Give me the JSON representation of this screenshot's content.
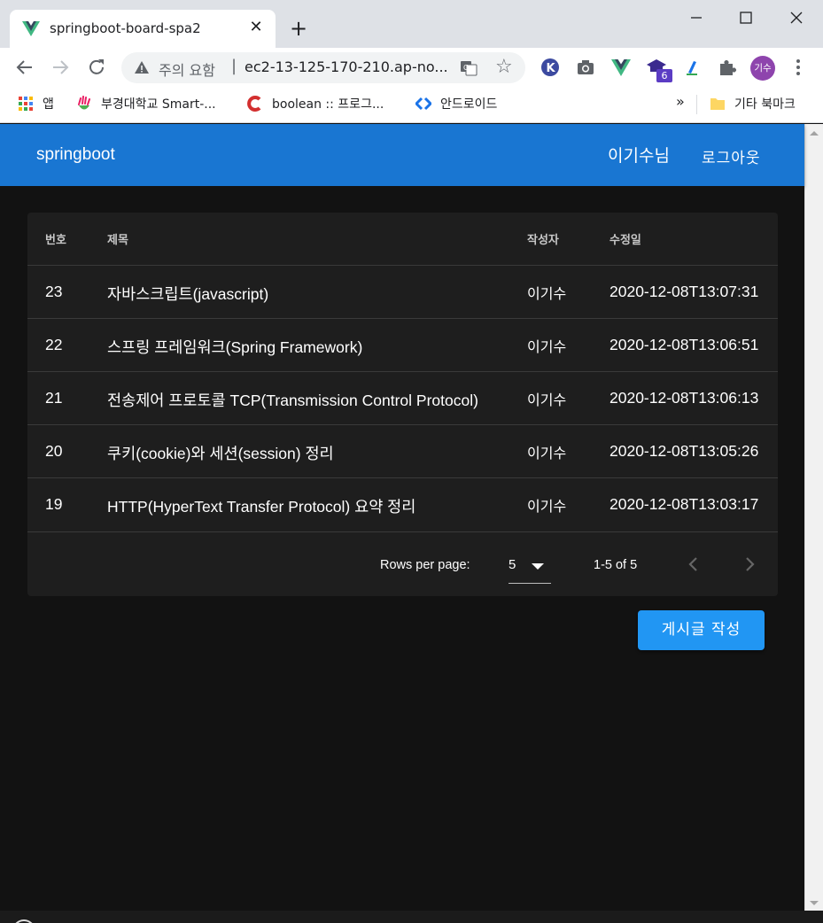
{
  "browser": {
    "tab_title": "springboot-board-spa2",
    "tab_close": "✕",
    "new_tab": "+",
    "address_warning": "주의 요함",
    "address_url": "ec2-13-125-170-210.ap-no...",
    "bookmark_star": "☆",
    "extension_badge": "6",
    "profile_initials": "기수",
    "bookmarks": [
      {
        "label": "앱"
      },
      {
        "label": "부경대학교 Smart-..."
      },
      {
        "label": "boolean :: 프로그..."
      },
      {
        "label": "안드로이드"
      }
    ],
    "bookmarks_overflow": "»",
    "bookmarks_other": "기타 북마크"
  },
  "app": {
    "title": "springboot",
    "user": "이기수님",
    "logout": "로그아웃"
  },
  "table": {
    "headers": {
      "no": "번호",
      "title": "제목",
      "author": "작성자",
      "modified": "수정일"
    },
    "rows": [
      {
        "no": "23",
        "title": "자바스크립트(javascript)",
        "author": "이기수",
        "modified": "2020-12-08T13:07:31"
      },
      {
        "no": "22",
        "title": "스프링 프레임워크(Spring Framework)",
        "author": "이기수",
        "modified": "2020-12-08T13:06:51"
      },
      {
        "no": "21",
        "title": "전송제어 프로토콜 TCP(Transmission Control Protocol)",
        "author": "이기수",
        "modified": "2020-12-08T13:06:13"
      },
      {
        "no": "20",
        "title": "쿠키(cookie)와 세션(session) 정리",
        "author": "이기수",
        "modified": "2020-12-08T13:05:26"
      },
      {
        "no": "19",
        "title": "HTTP(HyperText Transfer Protocol) 요약 정리",
        "author": "이기수",
        "modified": "2020-12-08T13:03:17"
      }
    ],
    "footer": {
      "rows_per_page_label": "Rows per page:",
      "rows_per_page_value": "5",
      "range": "1-5 of 5"
    }
  },
  "write_button": "게시글 작성",
  "colors": {
    "appbar": "#1976d2",
    "background": "#121212",
    "card": "#1e1e1e",
    "write_button": "#2196f3"
  }
}
